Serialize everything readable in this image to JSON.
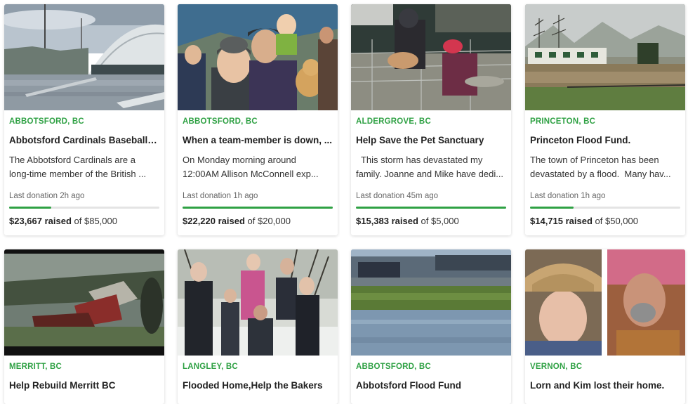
{
  "cards": [
    {
      "location": "ABBOTSFORD, BC",
      "title": "Abbotsford Cardinals Baseball F...",
      "desc1": "The Abbotsford Cardinals are a",
      "desc2": "long-time member of the British ...",
      "last_donation": "Last donation 2h ago",
      "raised": "$23,667 raised",
      "goal": "of $85,000",
      "progress": 0.28
    },
    {
      "location": "ABBOTSFORD, BC",
      "title": "When a team-member is down, ...",
      "desc1": "On Monday morning around",
      "desc2": "12:00AM Allison McConnell exp...",
      "last_donation": "Last donation 1h ago",
      "raised": "$22,220 raised",
      "goal": "of $20,000",
      "progress": 1.0
    },
    {
      "location": "ALDERGROVE, BC",
      "title": "Help Save the Pet Sanctuary",
      "desc1": "  This storm has devastated my",
      "desc2": "family. Joanne and Mike have dedi...",
      "last_donation": "Last donation 45m ago",
      "raised": "$15,383 raised",
      "goal": "of $5,000",
      "progress": 1.0
    },
    {
      "location": "PRINCETON, BC",
      "title": "Princeton Flood Fund.",
      "desc1": "The town of Princeton has been",
      "desc2": "devastated by a flood.  Many hav...",
      "last_donation": "Last donation 1h ago",
      "raised": "$14,715 raised",
      "goal": "of $50,000",
      "progress": 0.29
    },
    {
      "location": "MERRITT, BC",
      "title": "Help Rebuild Merritt BC"
    },
    {
      "location": "LANGLEY, BC",
      "title": "Flooded Home,Help the Bakers"
    },
    {
      "location": "ABBOTSFORD, BC",
      "title": "Abbotsford Flood Fund"
    },
    {
      "location": "VERNON, BC",
      "title": "Lorn and Kim lost their home."
    }
  ],
  "colors": {
    "accent": "#2fa144",
    "track": "#e4e4e4"
  }
}
